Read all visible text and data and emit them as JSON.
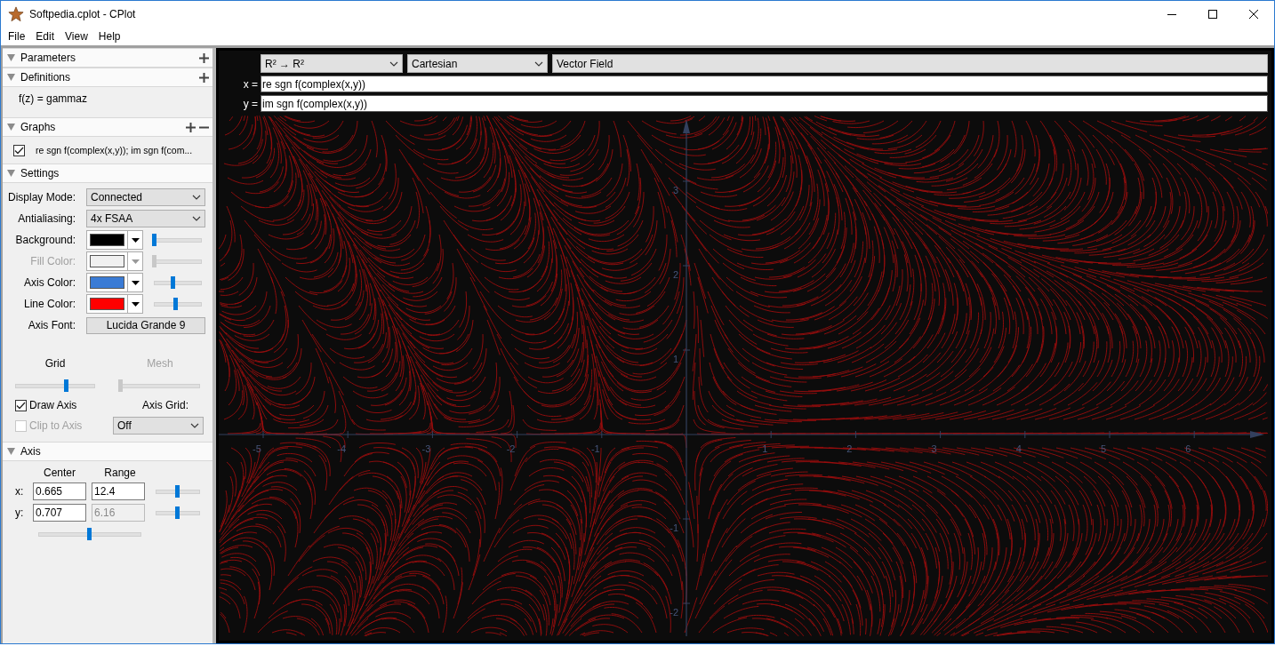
{
  "window": {
    "title": "Softpedia.cplot - CPlot"
  },
  "menu": [
    "File",
    "Edit",
    "View",
    "Help"
  ],
  "sections": {
    "parameters": {
      "title": "Parameters",
      "expanded": true,
      "can_add": true,
      "can_remove": false
    },
    "definitions": {
      "title": "Definitions",
      "expanded": true,
      "can_add": true,
      "can_remove": false,
      "items": [
        "f(z) = gammaz"
      ]
    },
    "graphs": {
      "title": "Graphs",
      "expanded": true,
      "can_add": true,
      "can_remove": true,
      "items": [
        {
          "label": "re sgn f(complex(x,y)); im sgn f(com...",
          "checked": true
        }
      ]
    },
    "settings": {
      "title": "Settings",
      "expanded": true,
      "can_add": false,
      "can_remove": false,
      "selects": [
        {
          "label": "Display Mode:",
          "value": "Connected"
        },
        {
          "label": "Antialiasing:",
          "value": "4x FSAA"
        }
      ],
      "colors": [
        {
          "label": "Background:",
          "color": "#000000",
          "level": 0.0,
          "disabled": false
        },
        {
          "label": "Fill Color:",
          "color": "#f0f0f0",
          "level": 0.0,
          "disabled": true
        },
        {
          "label": "Axis Color:",
          "color": "#3a7bd5",
          "level": 0.4,
          "disabled": false
        },
        {
          "label": "Line Color:",
          "color": "#ff0000",
          "level": 0.47,
          "disabled": false
        }
      ],
      "font": {
        "label": "Axis Font:",
        "value": "Lucida Grande 9"
      },
      "sliders": [
        {
          "label": "Grid",
          "level": 0.65,
          "disabled": false
        },
        {
          "label": "Mesh",
          "level": 0.0,
          "disabled": true
        }
      ],
      "checks": [
        {
          "label": "Draw Axis",
          "checked": true,
          "disabled": false
        },
        {
          "label": "Clip to Axis",
          "checked": false,
          "disabled": true
        }
      ],
      "axis_grid": {
        "label": "Axis Grid:",
        "value": "Off"
      }
    },
    "axis": {
      "title": "Axis",
      "expanded": true,
      "can_add": false,
      "can_remove": false,
      "columns": [
        "Center",
        "Range"
      ],
      "rows": [
        {
          "label": "x:",
          "center": "0.665",
          "range": "12.4",
          "range_disabled": false,
          "level": 0.5
        },
        {
          "label": "y:",
          "center": "0.707",
          "range": "6.16",
          "range_disabled": true,
          "level": 0.5
        }
      ],
      "zoom": {
        "level": 0.5
      }
    }
  },
  "selectors": [
    {
      "value": "R² → R²",
      "kind": "dropdown"
    },
    {
      "value": "Cartesian",
      "kind": "dropdown"
    },
    {
      "value": "Vector Field",
      "kind": "plain"
    }
  ],
  "equations": [
    {
      "label": "x =",
      "value": "re sgn f(complex(x,y))"
    },
    {
      "label": "y =",
      "value": "im sgn f(complex(x,y))"
    }
  ],
  "plot": {
    "x_negative": [
      "-5",
      "-4",
      "-3",
      "-2",
      "-1"
    ],
    "x_positive": [
      "1",
      "2",
      "3",
      "4",
      "5",
      "6"
    ],
    "y_positive": [
      "3",
      "2",
      "1"
    ],
    "y_negative": [
      "-1",
      "-2"
    ]
  }
}
